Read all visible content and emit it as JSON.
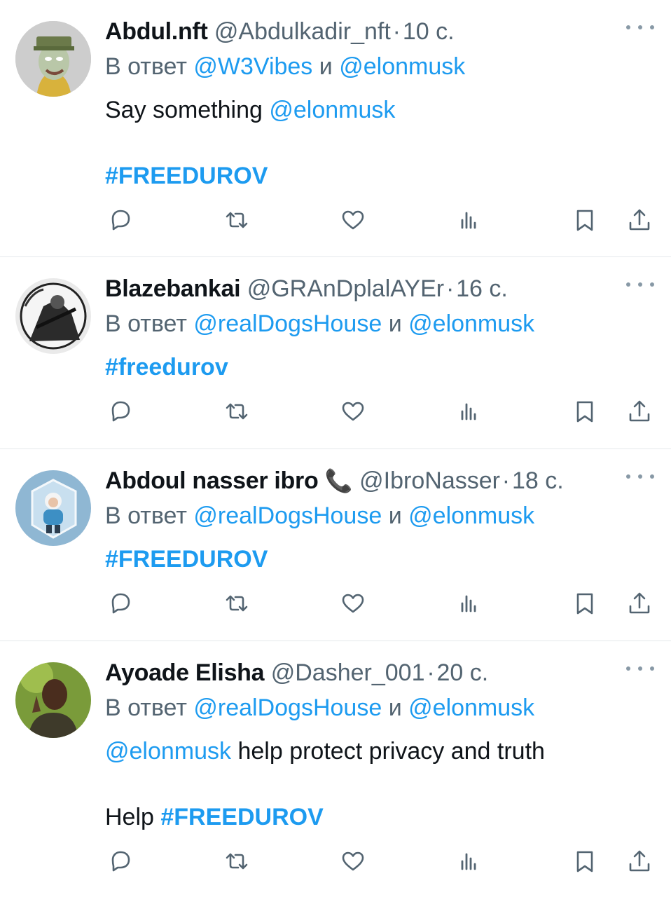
{
  "tweets": [
    {
      "name": "Abdul.nft",
      "handle": "@Abdulkadir_nft",
      "time": "10 с.",
      "reply_prefix": "В ответ",
      "reply_to_1": "@W3Vibes",
      "reply_and": "и",
      "reply_to_2": "@elonmusk",
      "line1_text": "Say something ",
      "line1_mention": "@elonmusk",
      "hashtag": "#FREEDUROV"
    },
    {
      "name": "Blazebankai",
      "handle": "@GRAnDplalAYEr",
      "time": "16 с.",
      "reply_prefix": "В ответ",
      "reply_to_1": "@realDogsHouse",
      "reply_and": "и",
      "reply_to_2": "@elonmusk",
      "hashtag": "#freedurov"
    },
    {
      "name": "Abdoul nasser ibro",
      "name_emoji": "📞",
      "handle": "@IbroNasser",
      "time": "18 с.",
      "reply_prefix": "В ответ",
      "reply_to_1": "@realDogsHouse",
      "reply_and": "и",
      "reply_to_2": "@elonmusk",
      "hashtag": "#FREEDUROV"
    },
    {
      "name": "Ayoade Elisha",
      "handle": "@Dasher_001",
      "time": "20 с.",
      "reply_prefix": "В ответ",
      "reply_to_1": "@realDogsHouse",
      "reply_and": "и",
      "reply_to_2": "@elonmusk",
      "line1_mention": "@elonmusk",
      "line1_text": " help protect privacy and truth",
      "line2_text": "Help ",
      "hashtag": "#FREEDUROV"
    }
  ],
  "separator": "·",
  "icons": [
    "reply-icon",
    "retweet-icon",
    "like-icon",
    "views-icon",
    "bookmark-icon",
    "share-icon",
    "more-icon"
  ],
  "colors": {
    "link": "#1d9bf0",
    "muted": "#536471",
    "text": "#0f1419"
  }
}
